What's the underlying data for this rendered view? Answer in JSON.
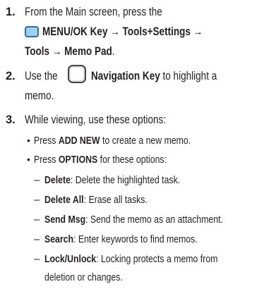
{
  "steps": [
    {
      "number": "1.",
      "line1": "From the Main screen, press the",
      "key_label": "MENU/OK Key",
      "arrow1": "→",
      "path1": "Tools+Settings",
      "arrow2": "→",
      "path2": "Tools",
      "arrow3": "→",
      "path3": "Memo Pad",
      "end": "."
    },
    {
      "number": "2.",
      "prefix": "Use the",
      "key_label": "Navigation Key",
      "suffix": "to highlight a",
      "line2": "memo."
    },
    {
      "number": "3.",
      "text": "While viewing, use these options:"
    }
  ],
  "bullets": [
    {
      "marker": "•",
      "pre": "Press",
      "bold": "ADD NEW",
      "post": "to create a new memo."
    },
    {
      "marker": "•",
      "pre": "Press",
      "bold": "OPTIONS",
      "post": "for these options:"
    }
  ],
  "options": [
    {
      "marker": "–",
      "term": "Delete",
      "desc": ": Delete the highlighted task."
    },
    {
      "marker": "–",
      "term": "Delete All",
      "desc": ": Erase all tasks."
    },
    {
      "marker": "–",
      "term": "Send Msg",
      "desc": ": Send the memo as an attachment."
    },
    {
      "marker": "–",
      "term": "Search",
      "desc": ": Enter keywords to find memos."
    },
    {
      "marker": "–",
      "term": "Lock/Unlock",
      "desc": ": Locking protects a memo from",
      "desc2": "deletion or changes."
    }
  ],
  "icons": {
    "menu_key": "menu-ok-key-icon",
    "nav_key": "navigation-key-icon",
    "menu_key_color": "#9fd1ef",
    "menu_key_border": "#2f6f9a"
  }
}
